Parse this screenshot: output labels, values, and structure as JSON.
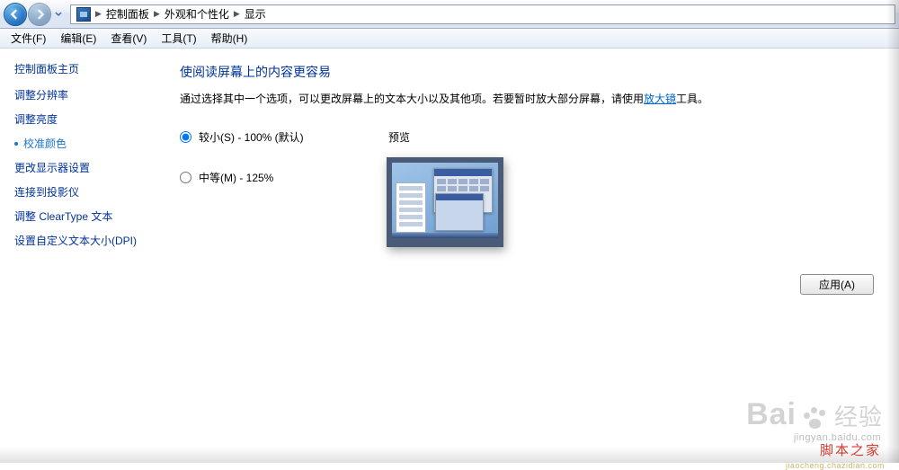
{
  "breadcrumb": {
    "root": "控制面板",
    "level1": "外观和个性化",
    "level2": "显示"
  },
  "menu": {
    "file": "文件(F)",
    "edit": "编辑(E)",
    "view": "查看(V)",
    "tools": "工具(T)",
    "help": "帮助(H)"
  },
  "sidebar": {
    "home": "控制面板主页",
    "items": [
      "调整分辨率",
      "调整亮度",
      "校准颜色",
      "更改显示器设置",
      "连接到投影仪",
      "调整 ClearType 文本",
      "设置自定义文本大小(DPI)"
    ],
    "current_index": 2
  },
  "main": {
    "title": "使阅读屏幕上的内容更容易",
    "desc_before": "通过选择其中一个选项，可以更改屏幕上的文本大小以及其他项。若要暂时放大部分屏幕，请使用",
    "desc_link": "放大镜",
    "desc_after": "工具。",
    "options": [
      {
        "label": "较小(S) - 100% (默认)",
        "checked": true
      },
      {
        "label": "中等(M) - 125%",
        "checked": false
      }
    ],
    "preview_label": "预览",
    "apply": "应用(A)"
  },
  "watermark": {
    "brand_en": "Bai",
    "brand_cn": "经验",
    "url": "jingyan.baidu.com",
    "red": "脚本之家",
    "redsub": "jiaocheng.chazidian.com"
  }
}
